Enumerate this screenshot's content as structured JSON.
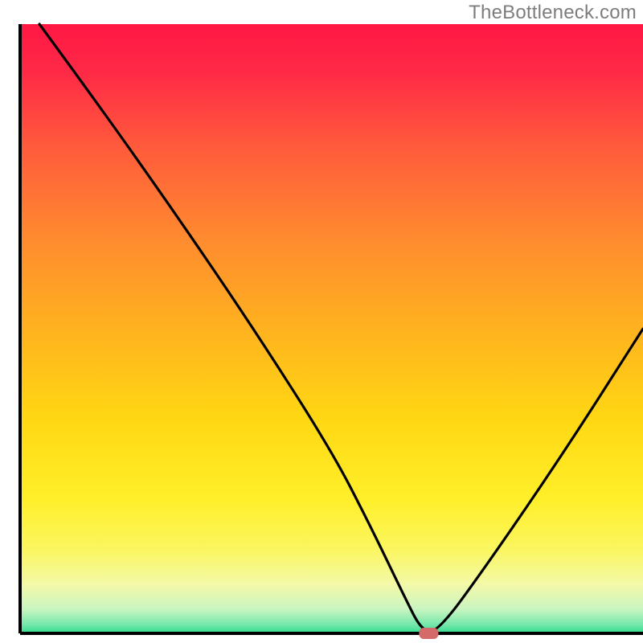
{
  "attribution": "TheBottleneck.com",
  "chart_data": {
    "type": "line",
    "title": "",
    "xlabel": "",
    "ylabel": "",
    "xlim": [
      0,
      100
    ],
    "ylim": [
      0,
      100
    ],
    "grid": false,
    "legend": false,
    "series": [
      {
        "name": "bottleneck-curve",
        "x": [
          3.1,
          12.5,
          25.0,
          37.5,
          50.0,
          56.3,
          61.9,
          64.4,
          66.9,
          75.0,
          87.5,
          100.0
        ],
        "values": [
          100.0,
          86.9,
          68.8,
          50.0,
          30.0,
          17.5,
          5.6,
          0.6,
          0.0,
          11.3,
          30.0,
          50.0
        ]
      }
    ],
    "marker": {
      "name": "optimal-marker",
      "x": 65.6,
      "y": 0.0,
      "width_x": 3.1,
      "color": "#d46a6a"
    },
    "frame": {
      "x": [
        3.1,
        100.0
      ],
      "y": [
        0.0,
        100.0
      ],
      "stroke": "#000000",
      "stroke_width": 4
    },
    "background_gradient": {
      "stops": [
        {
          "offset": 0.0,
          "color": "#ff1744"
        },
        {
          "offset": 0.08,
          "color": "#ff2a46"
        },
        {
          "offset": 0.2,
          "color": "#ff5a3c"
        },
        {
          "offset": 0.35,
          "color": "#ff8a2f"
        },
        {
          "offset": 0.5,
          "color": "#ffb21f"
        },
        {
          "offset": 0.65,
          "color": "#ffd813"
        },
        {
          "offset": 0.78,
          "color": "#ffef2a"
        },
        {
          "offset": 0.86,
          "color": "#fbf65e"
        },
        {
          "offset": 0.92,
          "color": "#f3f9a8"
        },
        {
          "offset": 0.96,
          "color": "#caf5c1"
        },
        {
          "offset": 0.985,
          "color": "#78e8ab"
        },
        {
          "offset": 1.0,
          "color": "#2fdc8f"
        }
      ]
    }
  }
}
